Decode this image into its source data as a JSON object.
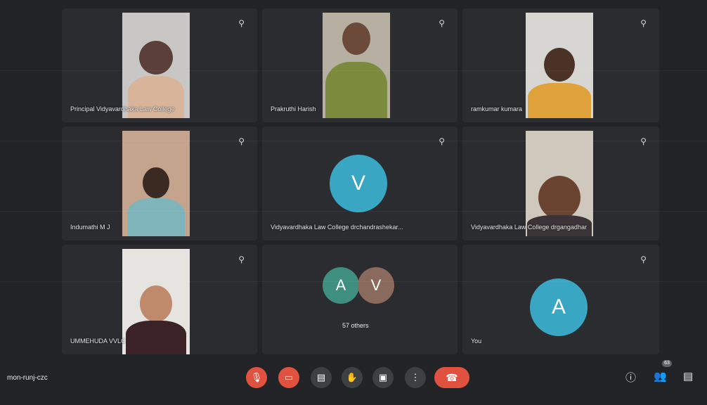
{
  "tiles": [
    {
      "name": "Principal Vidyavardhaka Law College"
    },
    {
      "name": "Prakruthi Harish"
    },
    {
      "name": "ramkumar kumara"
    },
    {
      "name": "Indumathi M J"
    },
    {
      "name": "Vidyavardhaka Law College drchandrashekar..."
    },
    {
      "name": "Vidyavardhaka Law College drgangadhar"
    },
    {
      "name": "UMMEHUDA VVLC"
    },
    {
      "name": "57 others"
    },
    {
      "name": "You"
    }
  ],
  "avatars": {
    "tile5_letter": "V",
    "others_letter_1": "A",
    "others_letter_2": "V",
    "you_letter": "A"
  },
  "colors": {
    "avatar_teal": "#39a6c4",
    "avatar_green": "#3e8f80",
    "avatar_brown": "#8a6a5c",
    "hangup_red": "#e0523f"
  },
  "meeting_code": "mon-runj-czc",
  "participants_count": "63",
  "icons": [
    "pin-icon",
    "mic-off-icon",
    "camera-off-icon",
    "captions-icon",
    "raise-hand-icon",
    "present-icon",
    "more-icon",
    "hangup-icon",
    "info-icon",
    "people-icon",
    "chat-icon"
  ]
}
